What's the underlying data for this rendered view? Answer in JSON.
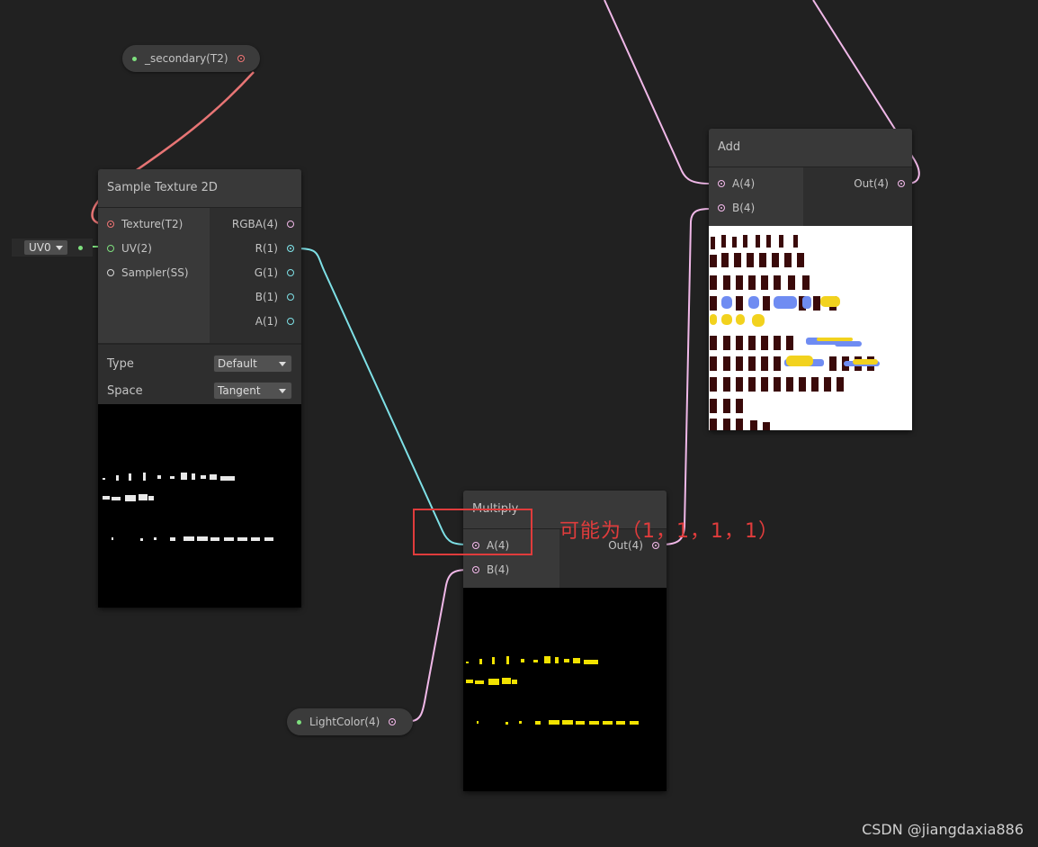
{
  "colors": {
    "canvas": "#212121",
    "wire_texture": "#e87575",
    "wire_uv": "#7ee07e",
    "wire_vector4": "#f0b8e8",
    "wire_vector1": "#7ee0e6",
    "annotation": "#e03c3c"
  },
  "property_nodes": {
    "secondary": {
      "label": "_secondary(T2)"
    },
    "light_color": {
      "label": "LightColor(4)"
    }
  },
  "uv_dropdown": {
    "value": "UV0"
  },
  "sample_texture": {
    "title": "Sample Texture 2D",
    "inputs": [
      "Texture(T2)",
      "UV(2)",
      "Sampler(SS)"
    ],
    "outputs": [
      "RGBA(4)",
      "R(1)",
      "G(1)",
      "B(1)",
      "A(1)"
    ],
    "settings": {
      "type_label": "Type",
      "type_value": "Default",
      "space_label": "Space",
      "space_value": "Tangent"
    }
  },
  "multiply": {
    "title": "Multiply",
    "inputs": [
      "A(4)",
      "B(4)"
    ],
    "outputs": [
      "Out(4)"
    ]
  },
  "add": {
    "title": "Add",
    "inputs": [
      "A(4)",
      "B(4)"
    ],
    "outputs": [
      "Out(4)"
    ]
  },
  "annotation": {
    "text": "可能为（1，1，1，1）"
  },
  "watermark": "CSDN @jiangdaxia886"
}
